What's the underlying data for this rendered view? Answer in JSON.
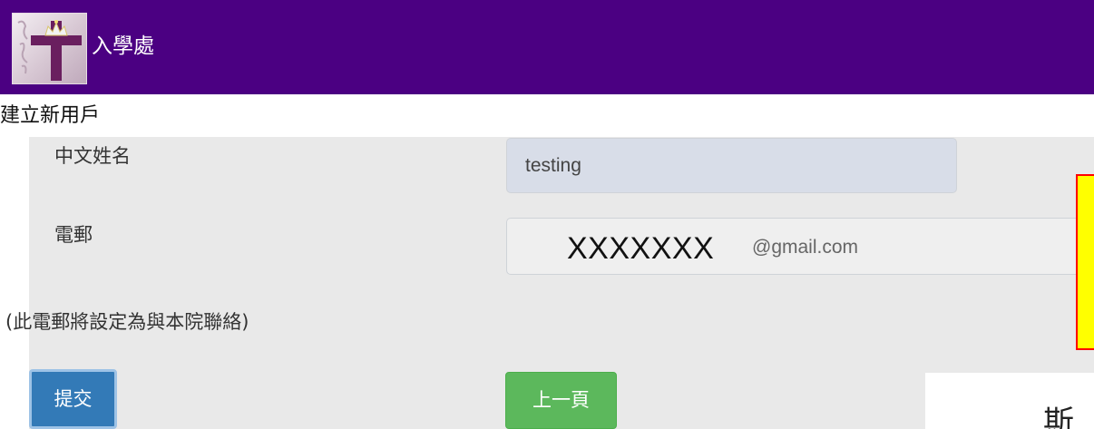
{
  "header": {
    "title": "入學處"
  },
  "form": {
    "heading": "建立新用戶",
    "name_label": "中文姓名",
    "name_value": "testing",
    "email_label": "電郵",
    "email_masked": "XXXXXXX",
    "email_domain": "@gmail.com",
    "email_note": "(此電郵將設定為與本院聯絡)",
    "submit_label": "提交",
    "back_label": "上一頁"
  },
  "overlay": {
    "partial_text": "斯"
  },
  "colors": {
    "header_bg": "#4b0082",
    "panel_bg": "#e9e9e9",
    "submit_bg": "#337ab7",
    "back_bg": "#5cb85c",
    "callout_fill": "#ffff00",
    "callout_border": "#ff0000"
  },
  "icons": {
    "logo": "cross-crown-logo"
  }
}
